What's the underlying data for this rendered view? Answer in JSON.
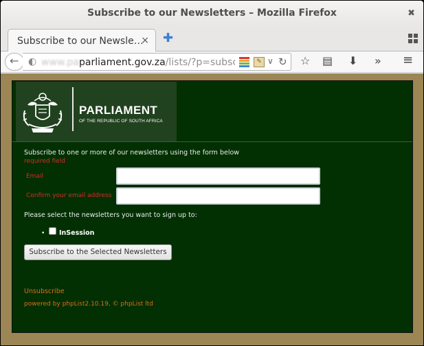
{
  "window": {
    "title": "Subscribe to our Newsletters – Mozilla Firefox",
    "close_glyph": "✖"
  },
  "tabs": [
    {
      "label": "Subscribe to our Newsle…",
      "close_glyph": "×"
    }
  ],
  "new_tab_glyph": "✚",
  "address_bar": {
    "url_hidden": "www.pa",
    "url_domain": "parliament.gov.za",
    "url_path": "/lists/?p=subscrit",
    "icons": [
      "globe-icon",
      "ext-color-icon",
      "ext-sketch-icon",
      "dropdown-icon",
      "reload-icon"
    ]
  },
  "toolbar_icons": [
    "bookmark-star-icon",
    "reading-list-icon",
    "download-icon",
    "overflow-icon",
    "menu-icon"
  ],
  "page": {
    "logo": {
      "name": "PARLIAMENT",
      "subtitle": "OF THE REPUBLIC OF SOUTH AFRICA"
    },
    "intro": "Subscribe to one or more of our newsletters using the form below",
    "required_note": "required field",
    "fields": [
      {
        "label": "Email",
        "value": ""
      },
      {
        "label": "Confirm your email address",
        "value": ""
      }
    ],
    "select_prompt": "Please select the newsletters you want to sign up to:",
    "newsletters": [
      {
        "label": "InSession",
        "checked": false
      }
    ],
    "submit_label": "Subscribe to the Selected Newsletters",
    "unsubscribe_label": "Unsubscribe",
    "powered_by": "powered by phpList2.10.19, © phpList ltd"
  },
  "colors": {
    "page_background": "#023002",
    "outer_background": "#9d8656",
    "required_text": "#d92a2a",
    "link_text": "#e06a20",
    "logo_background": "#21421f"
  }
}
